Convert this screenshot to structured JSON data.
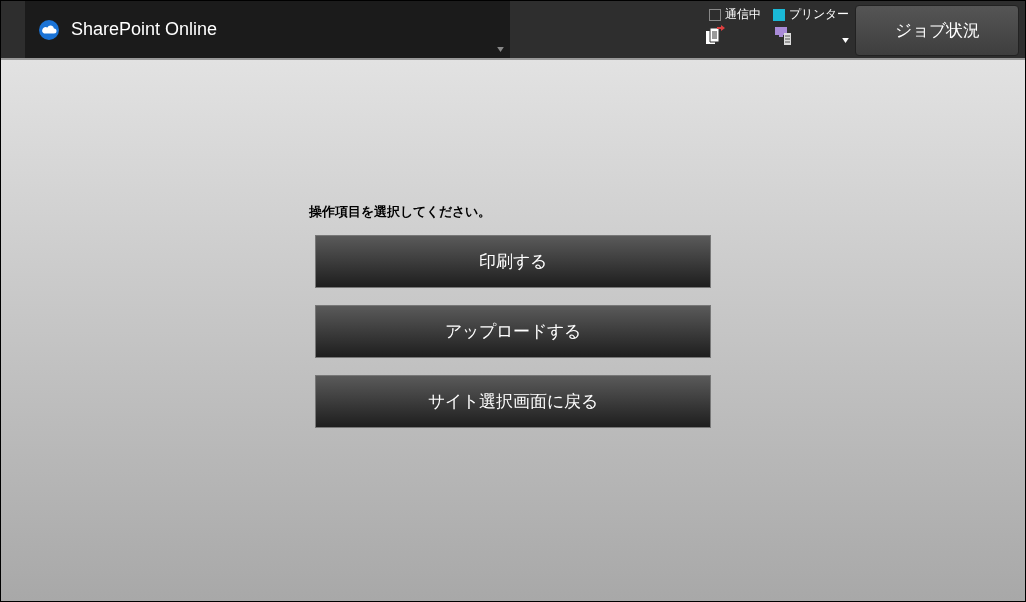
{
  "header": {
    "title": "SharePoint Online",
    "indicators": [
      {
        "label": "通信中",
        "on": false
      },
      {
        "label": "プリンター",
        "on": true
      }
    ],
    "job_button": "ジョブ状況"
  },
  "prompt": "操作項目を選択してください。",
  "actions": [
    "印刷する",
    "アップロードする",
    "サイト選択画面に戻る"
  ]
}
